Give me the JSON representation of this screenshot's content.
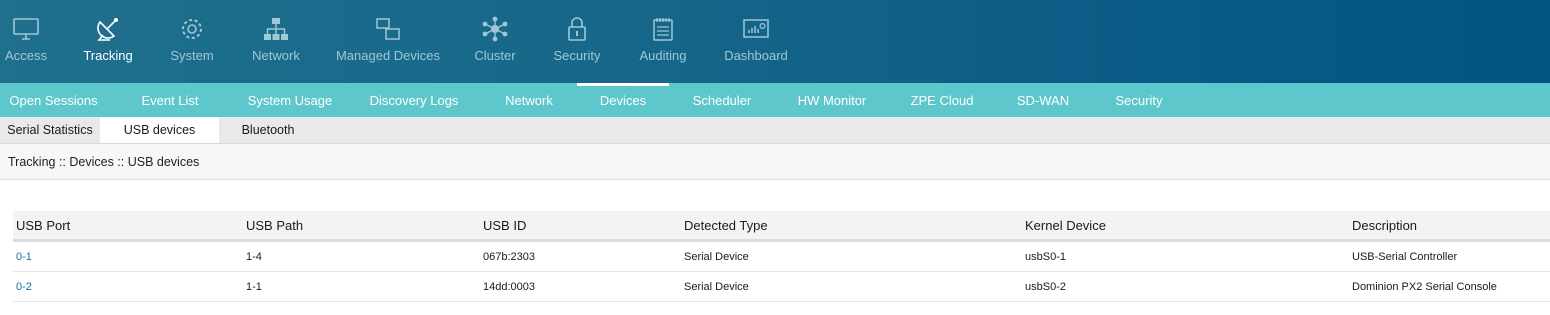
{
  "top_nav": [
    {
      "label": "Access",
      "icon": "monitor-icon",
      "active": false
    },
    {
      "label": "Tracking",
      "icon": "satellite-icon",
      "active": true
    },
    {
      "label": "System",
      "icon": "gear-icon",
      "active": false
    },
    {
      "label": "Network",
      "icon": "network-icon",
      "active": false
    },
    {
      "label": "Managed Devices",
      "icon": "devices-icon",
      "active": false
    },
    {
      "label": "Cluster",
      "icon": "cluster-icon",
      "active": false
    },
    {
      "label": "Security",
      "icon": "lock-icon",
      "active": false
    },
    {
      "label": "Auditing",
      "icon": "notepad-icon",
      "active": false
    },
    {
      "label": "Dashboard",
      "icon": "dashboard-icon",
      "active": false
    }
  ],
  "sub_nav": [
    {
      "label": "Open Sessions"
    },
    {
      "label": "Event List"
    },
    {
      "label": "System Usage"
    },
    {
      "label": "Discovery Logs"
    },
    {
      "label": "Network"
    },
    {
      "label": "Devices",
      "active": true
    },
    {
      "label": "Scheduler"
    },
    {
      "label": "HW Monitor"
    },
    {
      "label": "ZPE Cloud"
    },
    {
      "label": "SD-WAN"
    },
    {
      "label": "Security"
    }
  ],
  "tabs": [
    {
      "label": "Serial Statistics"
    },
    {
      "label": "USB devices",
      "active": true
    },
    {
      "label": "Bluetooth"
    }
  ],
  "breadcrumb": "Tracking :: Devices :: USB devices",
  "table": {
    "headers": [
      "USB Port",
      "USB Path",
      "USB ID",
      "Detected Type",
      "Kernel Device",
      "Description"
    ],
    "rows": [
      [
        "0-1",
        "1-4",
        "067b:2303",
        "Serial Device",
        "usbS0-1",
        "USB-Serial Controller"
      ],
      [
        "0-2",
        "1-1",
        "14dd:0003",
        "Serial Device",
        "usbS0-2",
        "Dominion PX2 Serial Console"
      ]
    ]
  },
  "colors": {
    "topnav_start": "#1f6f8d",
    "topnav_end": "#045482",
    "subnav": "#5ec7cc",
    "link": "#1a6fa0"
  }
}
